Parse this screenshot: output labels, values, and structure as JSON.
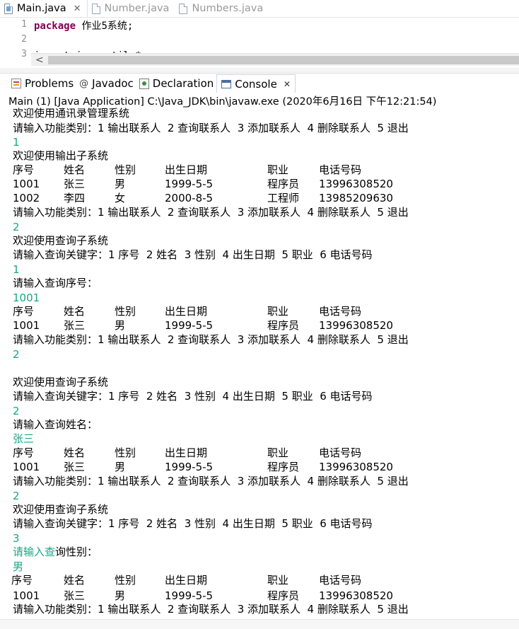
{
  "editor_tabs": [
    {
      "label": "Main.java",
      "active": true,
      "close": "✕"
    },
    {
      "label": "Number.java",
      "active": false
    },
    {
      "label": "Numbers.java",
      "active": false
    }
  ],
  "editor": {
    "lines": [
      {
        "num": "1",
        "keyword": "package",
        "rest": " 作业5系统;"
      },
      {
        "num": "2",
        "keyword": "",
        "rest": ""
      },
      {
        "num": "3",
        "keyword": "",
        "rest": "import java.util.*;"
      }
    ],
    "scroll_arrow": "<"
  },
  "view_tabs": [
    {
      "label": "Problems"
    },
    {
      "label": "Javadoc",
      "icon_text": "@"
    },
    {
      "label": "Declaration"
    },
    {
      "label": "Console",
      "active": true,
      "close": "✕"
    }
  ],
  "console_header": "Main (1) [Java Application] C:\\Java_JDK\\bin\\javaw.exe (2020年6月16日 下午12:21:54)",
  "console": {
    "menu_prompt": "请输入功能类别：1 输出联系人  2 查询联系人  3 添加联系人  4 删除联系人  5 退出",
    "query_prompt": "请输入查询关键字：1 序号  2 姓名  3 性别  4 出生日期  5 职业  6 电话号码",
    "welcome_main": "欢迎使用通讯录管理系统",
    "welcome_output": "欢迎使用输出子系统",
    "welcome_query": "欢迎使用查询子系统",
    "input_1": "1",
    "input_2": "2",
    "input_3": "3",
    "prompt_seq": "请输入查询序号：",
    "input_seq": "1001",
    "prompt_name": "请输入查询姓名：",
    "input_name": "张三",
    "prompt_gender_highlight": "请输入查",
    "prompt_gender_rest": "询性别：",
    "input_gender": "男",
    "headers": [
      "序号",
      "姓名",
      "性别",
      "出生日期",
      "职业",
      "电话号码"
    ],
    "row_1001": [
      "1001",
      "张三",
      "男",
      "1999-5-5",
      "程序员",
      "13996308520"
    ],
    "row_1002": [
      "1002",
      "李四",
      "女",
      "2000-8-5",
      "工程师",
      "13985209630"
    ]
  }
}
